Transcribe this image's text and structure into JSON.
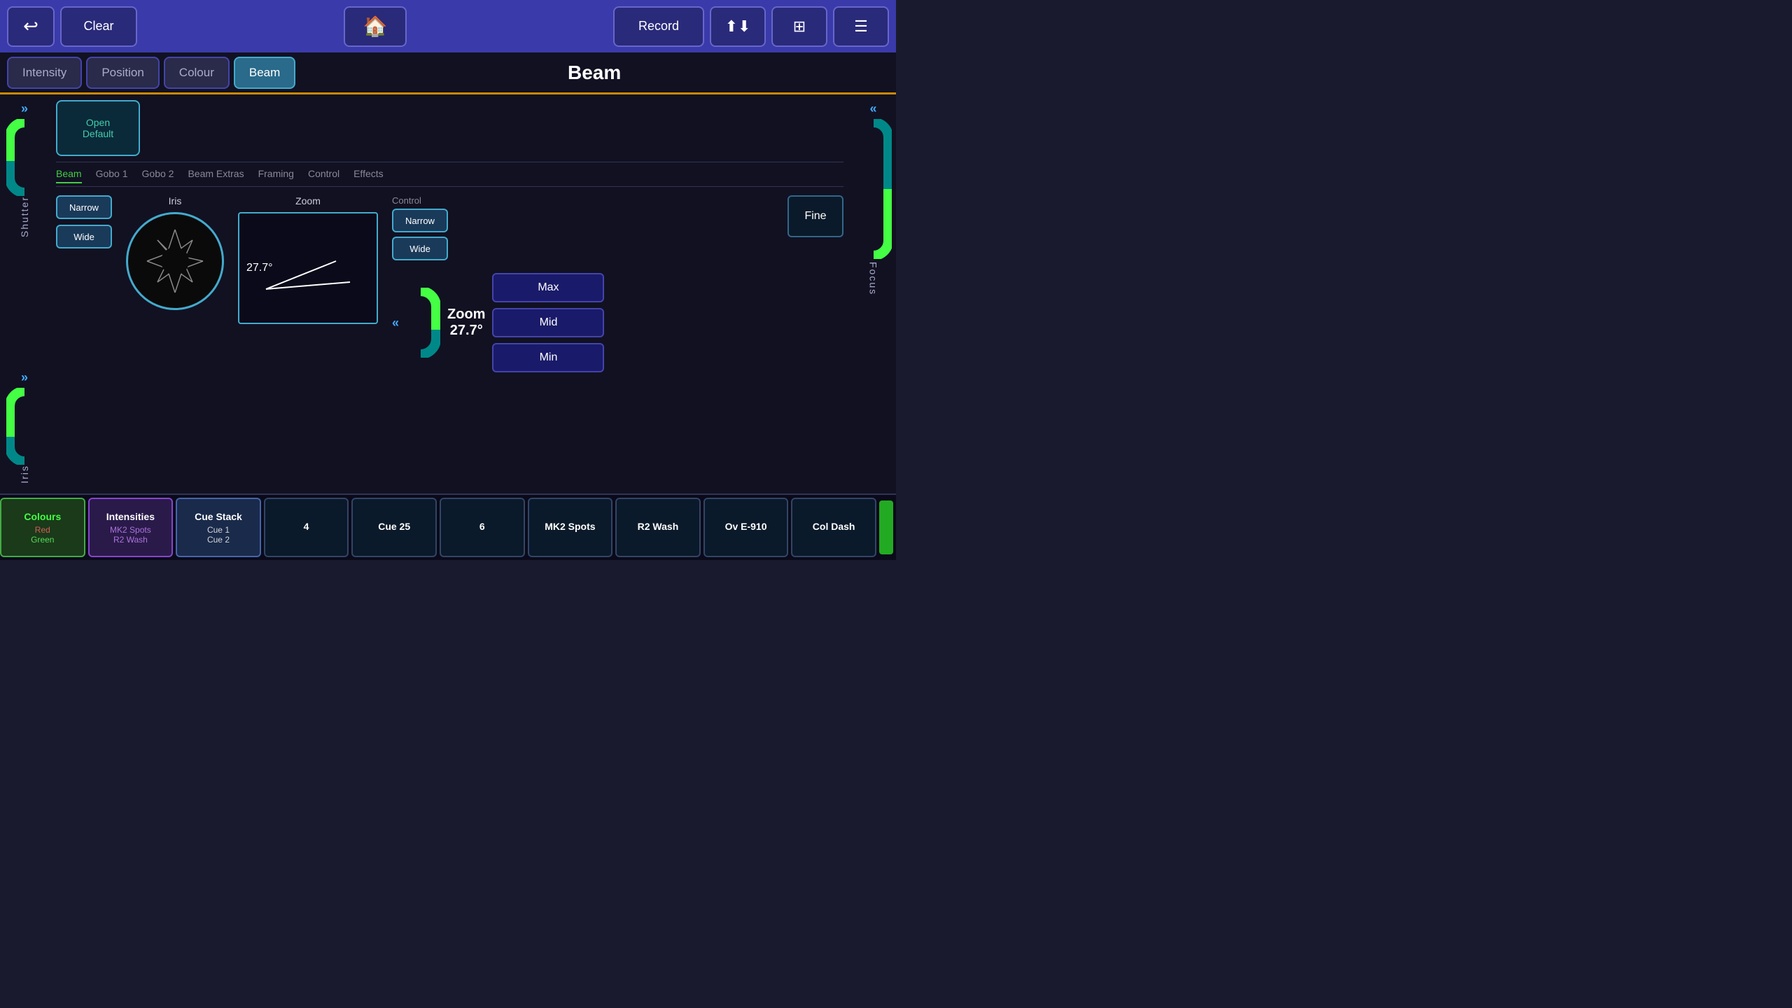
{
  "topBar": {
    "backIcon": "↩",
    "clearLabel": "Clear",
    "homeIcon": "⌂",
    "recordLabel": "Record",
    "upDownIcon": "⇅",
    "gridIcon": "⊞",
    "menuIcon": "☰"
  },
  "tabs": {
    "intensity": "Intensity",
    "position": "Position",
    "colour": "Colour",
    "beam": "Beam",
    "activeTitle": "Beam"
  },
  "goboSelector": {
    "openLabel": "Open",
    "defaultLabel": "Default"
  },
  "subTabs": [
    "Beam",
    "Gobo 1",
    "Gobo 2",
    "Beam Extras",
    "Framing",
    "Control",
    "Effects"
  ],
  "activeSubTab": "Beam",
  "gobo1": {
    "narrowLabel": "Narrow",
    "wideLabel": "Wide"
  },
  "iris": {
    "label": "Iris"
  },
  "zoom": {
    "label": "Zoom",
    "angle": "27.7°",
    "infoTitle": "Zoom",
    "infoValue": "27.7°"
  },
  "control": {
    "title": "Control",
    "narrowLabel": "Narrow",
    "wideLabel": "Wide"
  },
  "fineBtn": "Fine",
  "presets": {
    "max": "Max",
    "mid": "Mid",
    "min": "Min"
  },
  "leftDials": {
    "shutter": "Shutter",
    "iris": "Iris",
    "arrowIcon": ">>"
  },
  "rightDials": {
    "focus": "Focus",
    "arrowIcon": "<<"
  },
  "bottomBar": {
    "colours": {
      "title": "Colours",
      "sub1": "Red",
      "sub2": "Green"
    },
    "intensities": {
      "title": "Intensities",
      "sub1": "MK2 Spots",
      "sub2": "R2 Wash"
    },
    "cueStack": {
      "title": "Cue Stack",
      "sub1": "Cue 1",
      "sub2": "Cue 2"
    },
    "btn4": {
      "title": "4",
      "sub1": "",
      "sub2": ""
    },
    "cue25": {
      "title": "Cue 25",
      "sub1": "",
      "sub2": ""
    },
    "btn6": {
      "title": "6",
      "sub1": "",
      "sub2": ""
    },
    "mk2spots": {
      "title": "MK2 Spots",
      "sub1": "",
      "sub2": ""
    },
    "r2wash": {
      "title": "R2 Wash",
      "sub1": "",
      "sub2": ""
    },
    "ove910": {
      "title": "Ov E-910",
      "sub1": "",
      "sub2": ""
    },
    "coldash": {
      "title": "Col Dash",
      "sub1": "",
      "sub2": ""
    }
  }
}
